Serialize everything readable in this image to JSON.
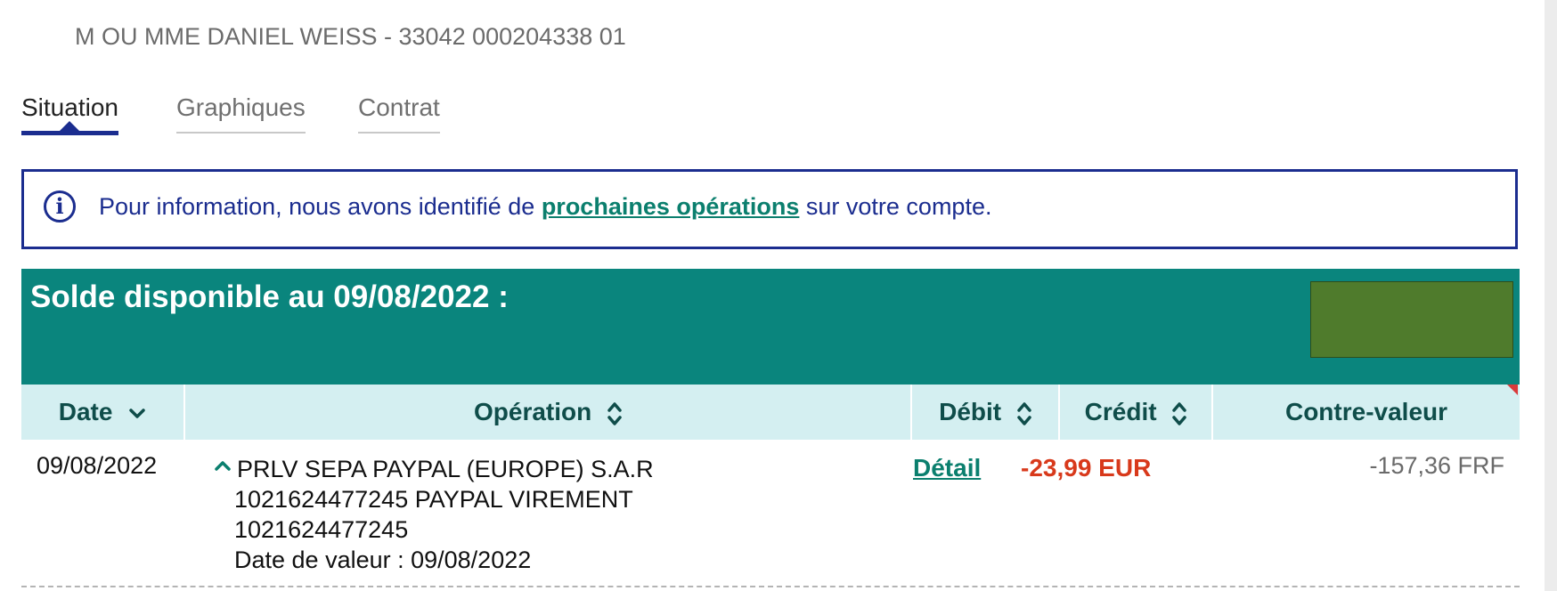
{
  "account": {
    "holder_line": "M OU MME DANIEL WEISS - 33042 000204338 01"
  },
  "tabs": [
    {
      "label": "Situation",
      "active": true
    },
    {
      "label": "Graphiques",
      "active": false
    },
    {
      "label": "Contrat",
      "active": false
    }
  ],
  "info": {
    "icon": "info-circle-icon",
    "text_before": "Pour information, nous avons identifié de ",
    "link_text": "prochaines opérations",
    "text_after": " sur votre compte."
  },
  "balance": {
    "title": "Solde disponible au 09/08/2022 :"
  },
  "table": {
    "columns": [
      {
        "label": "Date",
        "sort_icon": "chevron-down-icon"
      },
      {
        "label": "Opération",
        "sort_icon": "sort-updown-icon"
      },
      {
        "label": "Débit",
        "sort_icon": "sort-updown-icon"
      },
      {
        "label": "Crédit",
        "sort_icon": "sort-updown-icon"
      },
      {
        "label": "Contre-valeur",
        "sort_icon": ""
      }
    ],
    "rows": [
      {
        "date": "09/08/2022",
        "operation_lines": [
          "PRLV SEPA PAYPAL (EUROPE) S.A.R",
          "1021624477245 PAYPAL VIREMENT",
          "1021624477245",
          "Date de valeur : 09/08/2022"
        ],
        "detail_label": "Détail",
        "debit": "-23,99 EUR",
        "credit": "",
        "contre_valeur": "-157,36 FRF"
      }
    ]
  },
  "colors": {
    "navy": "#1b2d8f",
    "teal": "#0a857d",
    "header_bg": "#d4eff1",
    "debit_red": "#d8391b",
    "link_teal": "#0b7f6e",
    "redaction_green": "#4f7b2c"
  }
}
